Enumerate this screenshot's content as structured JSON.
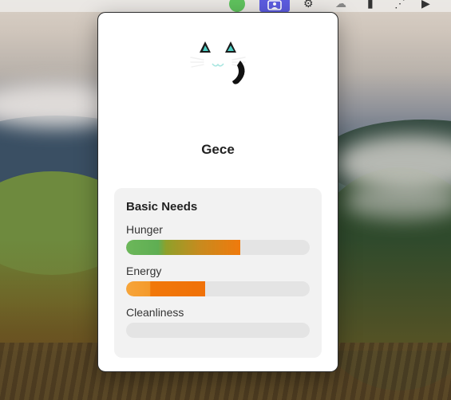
{
  "menubar": {
    "icons": [
      "green-status-dot",
      "pet-app-icon",
      "activity-icon",
      "cloud-icon",
      "battery-icon",
      "network-icon",
      "play-icon"
    ]
  },
  "pet": {
    "name": "Gece",
    "icon": "black-cat-face"
  },
  "basic_needs": {
    "title": "Basic Needs",
    "items": [
      {
        "label": "Hunger",
        "level": 0.62,
        "color": "#f07a0c"
      },
      {
        "label": "Energy",
        "level": 0.43,
        "color": "#f07108"
      },
      {
        "label": "Cleanliness",
        "level": 0.0,
        "color": "#c9c9c9"
      }
    ]
  }
}
